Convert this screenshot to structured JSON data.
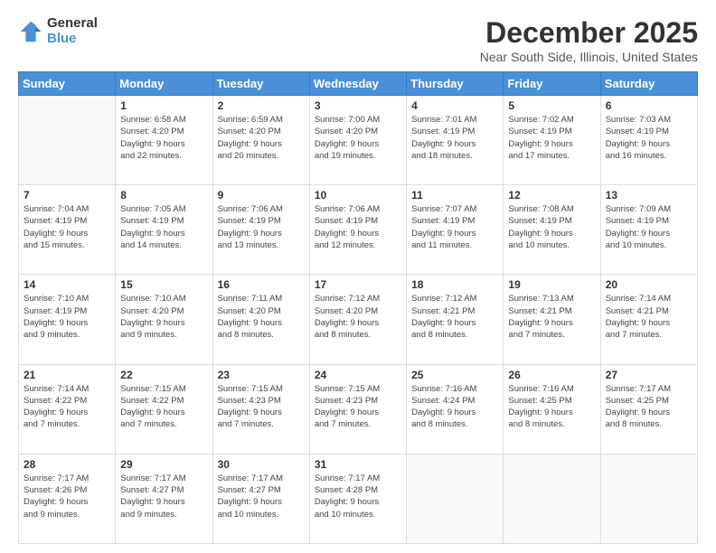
{
  "logo": {
    "general": "General",
    "blue": "Blue"
  },
  "title": "December 2025",
  "subtitle": "Near South Side, Illinois, United States",
  "days_header": [
    "Sunday",
    "Monday",
    "Tuesday",
    "Wednesday",
    "Thursday",
    "Friday",
    "Saturday"
  ],
  "weeks": [
    [
      {
        "day": "",
        "info": ""
      },
      {
        "day": "1",
        "info": "Sunrise: 6:58 AM\nSunset: 4:20 PM\nDaylight: 9 hours\nand 22 minutes."
      },
      {
        "day": "2",
        "info": "Sunrise: 6:59 AM\nSunset: 4:20 PM\nDaylight: 9 hours\nand 20 minutes."
      },
      {
        "day": "3",
        "info": "Sunrise: 7:00 AM\nSunset: 4:20 PM\nDaylight: 9 hours\nand 19 minutes."
      },
      {
        "day": "4",
        "info": "Sunrise: 7:01 AM\nSunset: 4:19 PM\nDaylight: 9 hours\nand 18 minutes."
      },
      {
        "day": "5",
        "info": "Sunrise: 7:02 AM\nSunset: 4:19 PM\nDaylight: 9 hours\nand 17 minutes."
      },
      {
        "day": "6",
        "info": "Sunrise: 7:03 AM\nSunset: 4:19 PM\nDaylight: 9 hours\nand 16 minutes."
      }
    ],
    [
      {
        "day": "7",
        "info": "Sunrise: 7:04 AM\nSunset: 4:19 PM\nDaylight: 9 hours\nand 15 minutes."
      },
      {
        "day": "8",
        "info": "Sunrise: 7:05 AM\nSunset: 4:19 PM\nDaylight: 9 hours\nand 14 minutes."
      },
      {
        "day": "9",
        "info": "Sunrise: 7:06 AM\nSunset: 4:19 PM\nDaylight: 9 hours\nand 13 minutes."
      },
      {
        "day": "10",
        "info": "Sunrise: 7:06 AM\nSunset: 4:19 PM\nDaylight: 9 hours\nand 12 minutes."
      },
      {
        "day": "11",
        "info": "Sunrise: 7:07 AM\nSunset: 4:19 PM\nDaylight: 9 hours\nand 11 minutes."
      },
      {
        "day": "12",
        "info": "Sunrise: 7:08 AM\nSunset: 4:19 PM\nDaylight: 9 hours\nand 10 minutes."
      },
      {
        "day": "13",
        "info": "Sunrise: 7:09 AM\nSunset: 4:19 PM\nDaylight: 9 hours\nand 10 minutes."
      }
    ],
    [
      {
        "day": "14",
        "info": "Sunrise: 7:10 AM\nSunset: 4:19 PM\nDaylight: 9 hours\nand 9 minutes."
      },
      {
        "day": "15",
        "info": "Sunrise: 7:10 AM\nSunset: 4:20 PM\nDaylight: 9 hours\nand 9 minutes."
      },
      {
        "day": "16",
        "info": "Sunrise: 7:11 AM\nSunset: 4:20 PM\nDaylight: 9 hours\nand 8 minutes."
      },
      {
        "day": "17",
        "info": "Sunrise: 7:12 AM\nSunset: 4:20 PM\nDaylight: 9 hours\nand 8 minutes."
      },
      {
        "day": "18",
        "info": "Sunrise: 7:12 AM\nSunset: 4:21 PM\nDaylight: 9 hours\nand 8 minutes."
      },
      {
        "day": "19",
        "info": "Sunrise: 7:13 AM\nSunset: 4:21 PM\nDaylight: 9 hours\nand 7 minutes."
      },
      {
        "day": "20",
        "info": "Sunrise: 7:14 AM\nSunset: 4:21 PM\nDaylight: 9 hours\nand 7 minutes."
      }
    ],
    [
      {
        "day": "21",
        "info": "Sunrise: 7:14 AM\nSunset: 4:22 PM\nDaylight: 9 hours\nand 7 minutes."
      },
      {
        "day": "22",
        "info": "Sunrise: 7:15 AM\nSunset: 4:22 PM\nDaylight: 9 hours\nand 7 minutes."
      },
      {
        "day": "23",
        "info": "Sunrise: 7:15 AM\nSunset: 4:23 PM\nDaylight: 9 hours\nand 7 minutes."
      },
      {
        "day": "24",
        "info": "Sunrise: 7:15 AM\nSunset: 4:23 PM\nDaylight: 9 hours\nand 7 minutes."
      },
      {
        "day": "25",
        "info": "Sunrise: 7:16 AM\nSunset: 4:24 PM\nDaylight: 9 hours\nand 8 minutes."
      },
      {
        "day": "26",
        "info": "Sunrise: 7:16 AM\nSunset: 4:25 PM\nDaylight: 9 hours\nand 8 minutes."
      },
      {
        "day": "27",
        "info": "Sunrise: 7:17 AM\nSunset: 4:25 PM\nDaylight: 9 hours\nand 8 minutes."
      }
    ],
    [
      {
        "day": "28",
        "info": "Sunrise: 7:17 AM\nSunset: 4:26 PM\nDaylight: 9 hours\nand 9 minutes."
      },
      {
        "day": "29",
        "info": "Sunrise: 7:17 AM\nSunset: 4:27 PM\nDaylight: 9 hours\nand 9 minutes."
      },
      {
        "day": "30",
        "info": "Sunrise: 7:17 AM\nSunset: 4:27 PM\nDaylight: 9 hours\nand 10 minutes."
      },
      {
        "day": "31",
        "info": "Sunrise: 7:17 AM\nSunset: 4:28 PM\nDaylight: 9 hours\nand 10 minutes."
      },
      {
        "day": "",
        "info": ""
      },
      {
        "day": "",
        "info": ""
      },
      {
        "day": "",
        "info": ""
      }
    ]
  ]
}
